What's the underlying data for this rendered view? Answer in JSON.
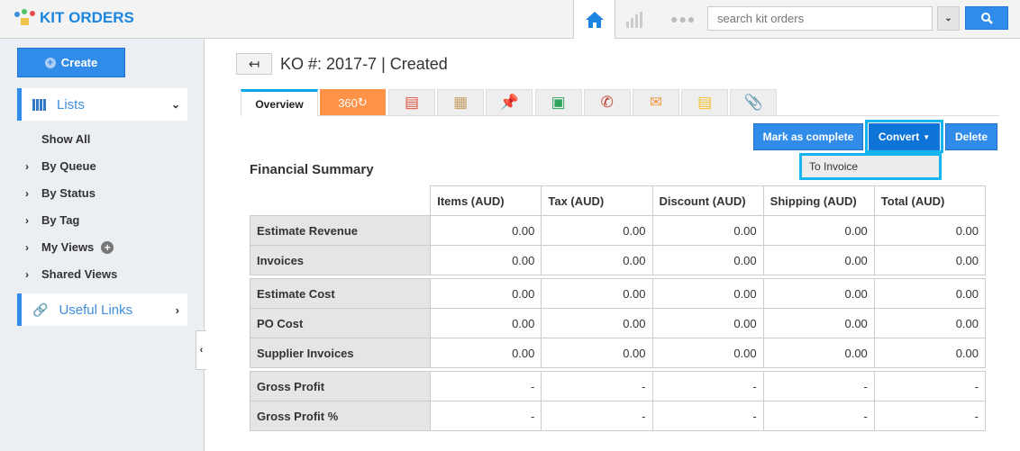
{
  "app": {
    "title": "KIT ORDERS",
    "search_placeholder": "search kit orders",
    "accent": "#318be9"
  },
  "sidebar": {
    "create_label": "Create",
    "lists_label": "Lists",
    "items": [
      {
        "label": "Show All",
        "chevron": false
      },
      {
        "label": "By Queue",
        "chevron": true
      },
      {
        "label": "By Status",
        "chevron": true
      },
      {
        "label": "By Tag",
        "chevron": true
      },
      {
        "label": "My Views",
        "chevron": true,
        "add": true
      },
      {
        "label": "Shared Views",
        "chevron": true
      }
    ],
    "useful_links_label": "Useful Links"
  },
  "page": {
    "title": "KO #: 2017-7 | Created"
  },
  "tabs": {
    "overview": "Overview",
    "t360": "360",
    "icons": [
      "list-icon",
      "calendar-icon",
      "pin-icon",
      "task-icon",
      "phone-icon",
      "email-icon",
      "note-icon",
      "attachment-icon"
    ]
  },
  "actions": {
    "mark_complete": "Mark as complete",
    "convert": "Convert",
    "delete": "Delete",
    "menu": [
      "To Invoice"
    ]
  },
  "summary": {
    "title": "Financial Summary",
    "columns": [
      "Items (AUD)",
      "Tax (AUD)",
      "Discount (AUD)",
      "Shipping (AUD)",
      "Total (AUD)"
    ],
    "groups": [
      [
        {
          "label": "Estimate Revenue",
          "values": [
            "0.00",
            "0.00",
            "0.00",
            "0.00",
            "0.00"
          ]
        },
        {
          "label": "Invoices",
          "values": [
            "0.00",
            "0.00",
            "0.00",
            "0.00",
            "0.00"
          ]
        }
      ],
      [
        {
          "label": "Estimate Cost",
          "values": [
            "0.00",
            "0.00",
            "0.00",
            "0.00",
            "0.00"
          ]
        },
        {
          "label": "PO Cost",
          "values": [
            "0.00",
            "0.00",
            "0.00",
            "0.00",
            "0.00"
          ]
        },
        {
          "label": "Supplier Invoices",
          "values": [
            "0.00",
            "0.00",
            "0.00",
            "0.00",
            "0.00"
          ]
        }
      ],
      [
        {
          "label": "Gross Profit",
          "values": [
            "-",
            "-",
            "-",
            "-",
            "-"
          ]
        },
        {
          "label": "Gross Profit %",
          "values": [
            "-",
            "-",
            "-",
            "-",
            "-"
          ]
        }
      ]
    ]
  }
}
